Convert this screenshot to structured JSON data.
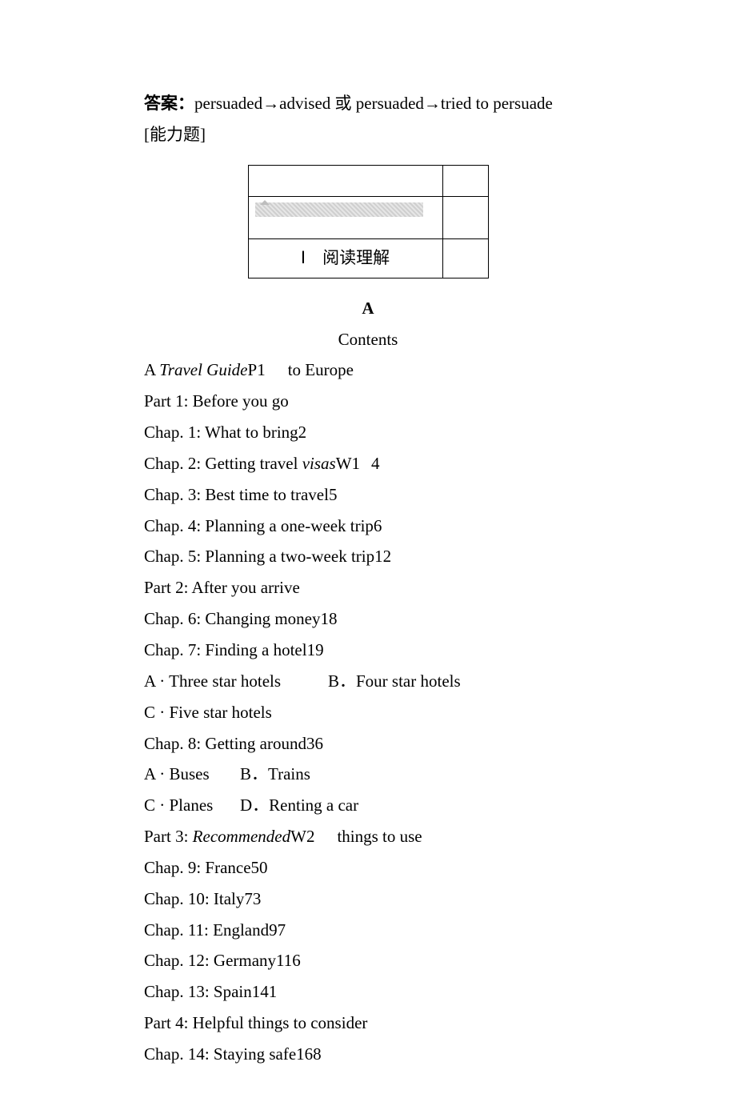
{
  "answerLine": {
    "label": "答案：",
    "content": "persuaded→advised 或 persuaded→tried to persuade"
  },
  "abilityLabel": "[能力题]",
  "boxLabel": "Ⅰ　阅读理解",
  "sectionA": "A",
  "contentsTitle": "Contents",
  "lines": {
    "l1a": "A ",
    "l1b": "Travel Guide",
    "l1c": "P1",
    "l1d": "to Europe",
    "l2": "Part 1: Before you go",
    "l3": "Chap. 1: What to bring2",
    "l4a": "Chap. 2: Getting travel ",
    "l4b": "visas",
    "l4c": "W1",
    "l4d": "4",
    "l5": "Chap. 3: Best time to travel5",
    "l6": "Chap. 4: Planning a one-week trip6",
    "l7": "Chap. 5: Planning a two-week trip12",
    "l8": "Part 2: After you arrive",
    "l9": "Chap. 6: Changing money18",
    "l10": "Chap. 7: Finding a hotel19",
    "l11a": "A · Three star hotels",
    "l11b": "B．Four star hotels",
    "l12": "C · Five star hotels",
    "l13": "Chap. 8: Getting around36",
    "l14a": "A · Buses",
    "l14b": "B．Trains",
    "l15a": "C · Planes",
    "l15b": "D．Renting a car",
    "l16a": "Part 3: ",
    "l16b": "Recommended",
    "l16c": "W2",
    "l16d": "things to use",
    "l17": "Chap. 9: France50",
    "l18": "Chap. 10: Italy73",
    "l19": "Chap. 11: England97",
    "l20": "Chap. 12: Germany116",
    "l21": "Chap. 13: Spain141",
    "l22": "Part 4: Helpful things to consider",
    "l23": "Chap. 14: Staying safe168"
  }
}
